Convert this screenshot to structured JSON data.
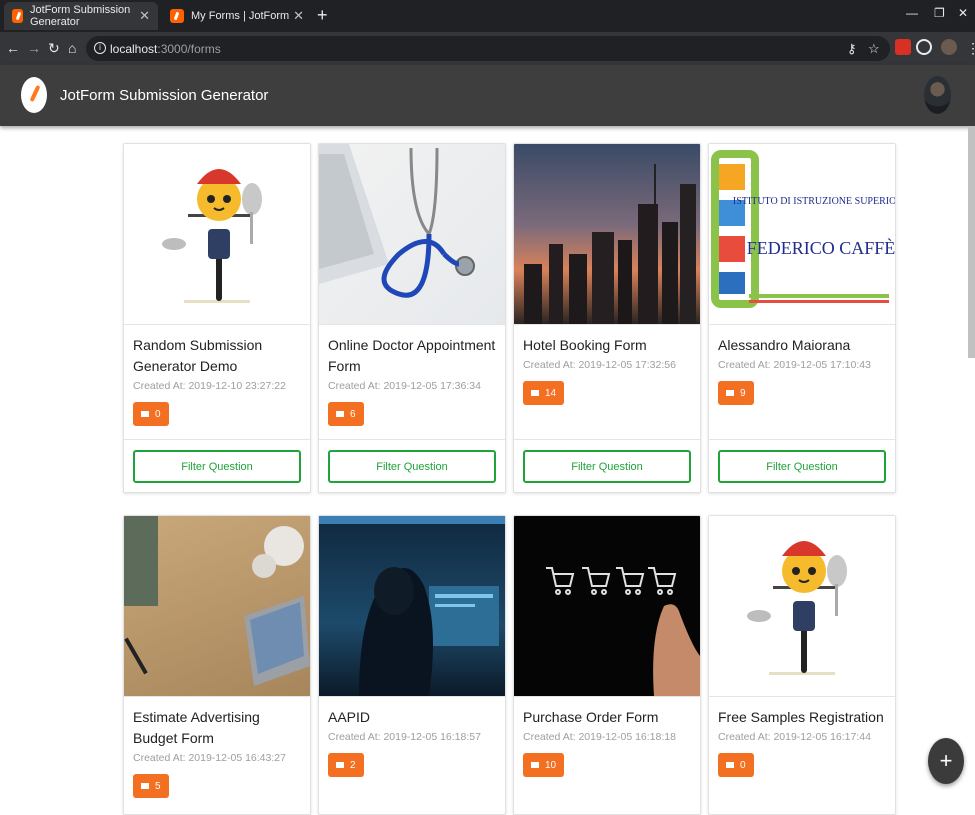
{
  "browser": {
    "tabs": [
      {
        "title": "JotForm Submission Generator"
      },
      {
        "title": "My Forms | JotForm"
      }
    ],
    "url_host": "localhost",
    "url_path": ":3000/forms"
  },
  "app": {
    "title": "JotForm Submission Generator"
  },
  "cards": [
    {
      "title": "Random Submission Generator Demo",
      "date": "Created At: 2019-12-10 23:27:22",
      "count": "0",
      "button": "Filter Question",
      "image": "bike-cat-mascot"
    },
    {
      "title": "Online Doctor Appointment Form",
      "date": "Created At: 2019-12-05 17:36:34",
      "count": "6",
      "button": "Filter Question",
      "image": "stethoscope"
    },
    {
      "title": "Hotel Booking Form",
      "date": "Created At: 2019-12-05 17:32:56",
      "count": "14",
      "button": "Filter Question",
      "image": "city-skyline"
    },
    {
      "title": "Alessandro Maiorana",
      "date": "Created At: 2019-12-05 17:10:43",
      "count": "9",
      "button": "Filter Question",
      "image": "school-banner",
      "image_text_1": "ISTITUTO DI ISTRUZIONE SUPERIORE",
      "image_text_2": "FEDERICO CAFFÈ"
    },
    {
      "title": "Estimate Advertising Budget Form",
      "date": "Created At: 2019-12-05 16:43:27",
      "count": "5",
      "image": "desk-laptop"
    },
    {
      "title": "AAPID",
      "date": "Created At: 2019-12-05 16:18:57",
      "count": "2",
      "image": "hacker"
    },
    {
      "title": "Purchase Order Form",
      "date": "Created At: 2019-12-05 16:18:18",
      "count": "10",
      "image": "shopping-carts"
    },
    {
      "title": "Free Samples Registration",
      "date": "Created At: 2019-12-05 16:17:44",
      "count": "0",
      "image": "bike-cat-mascot"
    }
  ],
  "fab_label": "+",
  "colors": {
    "accent": "#f36f21",
    "button_green": "#1fa33a",
    "appbar": "#3e3e3e"
  }
}
